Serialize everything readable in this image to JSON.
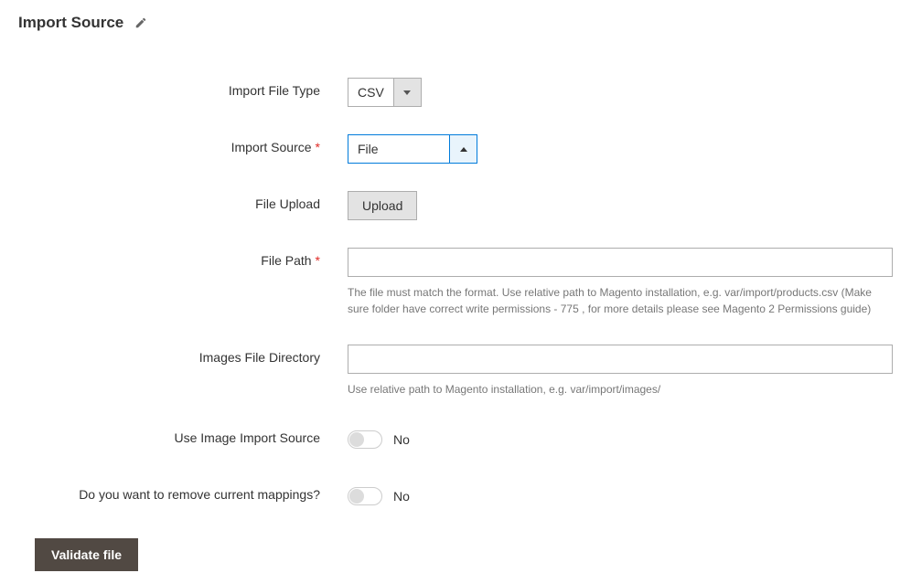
{
  "section": {
    "title": "Import Source"
  },
  "fields": {
    "import_file_type": {
      "label": "Import File Type",
      "value": "CSV"
    },
    "import_source": {
      "label": "Import Source",
      "value": "File"
    },
    "file_upload": {
      "label": "File Upload",
      "button": "Upload"
    },
    "file_path": {
      "label": "File Path",
      "value": "",
      "help": "The file must match the format. Use relative path to Magento installation, e.g. var/import/products.csv (Make sure folder have correct write permissions - 775 , for more details please see Magento 2 Permissions guide)"
    },
    "images_file_directory": {
      "label": "Images File Directory",
      "value": "",
      "help": "Use relative path to Magento installation, e.g. var/import/images/"
    },
    "use_image_import_source": {
      "label": "Use Image Import Source",
      "state": "No"
    },
    "remove_mappings": {
      "label": "Do you want to remove current mappings?",
      "state": "No"
    }
  },
  "actions": {
    "validate": "Validate file"
  }
}
